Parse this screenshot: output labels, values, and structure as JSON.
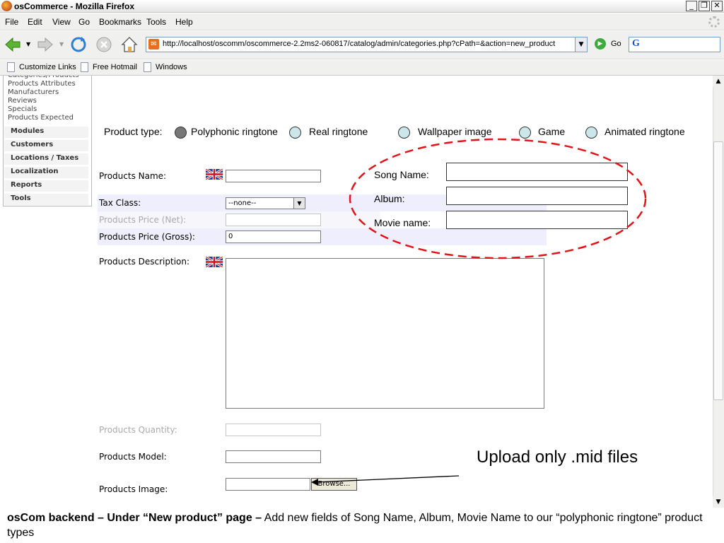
{
  "window": {
    "title": "osCommerce - Mozilla Firefox",
    "minimize_label": "_",
    "restore_label": "❐",
    "close_label": "✕"
  },
  "menubar": {
    "items": [
      "File",
      "Edit",
      "View",
      "Go",
      "Bookmarks",
      "Tools",
      "Help"
    ]
  },
  "navbar": {
    "url": "http://localhost/oscomm/oscommerce-2.2ms2-060817/catalog/admin/categories.php?cPath=&action=new_product",
    "go_label": "Go",
    "search_engine_glyph": "G"
  },
  "bookmarks": {
    "items": [
      "Customize Links",
      "Free Hotmail",
      "Windows"
    ]
  },
  "leftnav": {
    "catalog_links": [
      "Categories/Products",
      "Products Attributes",
      "Manufacturers",
      "Reviews",
      "Specials",
      "Products Expected"
    ],
    "sections": [
      "Modules",
      "Customers",
      "Locations / Taxes",
      "Localization",
      "Reports",
      "Tools"
    ]
  },
  "product_type": {
    "label": "Product type:",
    "options": [
      "Polyphonic ringtone",
      "Real ringtone",
      "Wallpaper image",
      "Game",
      "Animated ringtone"
    ],
    "selected": "Polyphonic ringtone"
  },
  "form": {
    "name_label": "Products Name:",
    "tax_label": "Tax Class:",
    "tax_value": "--none--",
    "price_net_label": "Products Price (Net):",
    "price_gross_label": "Products Price (Gross):",
    "price_gross_value": "0",
    "description_label": "Products Description:",
    "quantity_label": "Products Quantity:",
    "model_label": "Products Model:",
    "image_label": "Products Image:",
    "browse_label": "Browse..."
  },
  "song_fields": {
    "song_name_label": "Song Name:",
    "album_label": "Album:",
    "movie_name_label": "Movie name:"
  },
  "annotation": {
    "upload_note": "Upload only .mid files"
  },
  "caption": {
    "bold": "osCom backend – Under “New product” page –",
    "rest": " Add new fields of Song Name, Album, Movie Name to our “polyphonic ringtone” product types"
  },
  "colors": {
    "annotation_red": "#e0141a",
    "row_band": "#eeeefd",
    "radio_fill": "#cde6ea"
  }
}
